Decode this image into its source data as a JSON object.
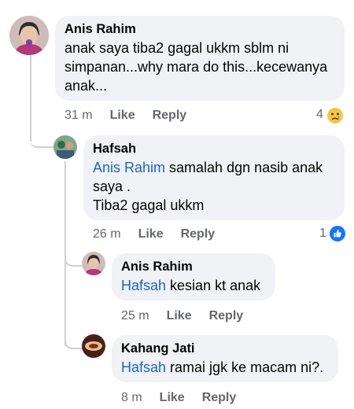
{
  "comments": [
    {
      "author": "Anis Rahim",
      "text": "anak saya tiba2 gagal ukkm sblm ni simpanan...why mara do this...kecewanya anak...",
      "time": "31 m",
      "like": "Like",
      "reply": "Reply",
      "reaction_count": "4",
      "reaction_icon": "sad-face-icon"
    },
    {
      "author": "Hafsah",
      "mention": "Anis Rahim",
      "text_line1": " samalah dgn nasib anak",
      "text_line2": "saya .",
      "text_line3": "Tiba2 gagal ukkm",
      "time": "26 m",
      "like": "Like",
      "reply": "Reply",
      "reaction_count": "1",
      "reaction_icon": "like-thumb-icon"
    },
    {
      "author": "Anis Rahim",
      "mention": "Hafsah",
      "text": " kesian kt anak",
      "time": "25 m",
      "like": "Like",
      "reply": "Reply"
    },
    {
      "author": "Kahang Jati",
      "mention": "Hafsah",
      "text": " ramai jgk ke macam ni?.",
      "time": "8 m",
      "like": "Like",
      "reply": "Reply"
    }
  ],
  "colors": {
    "bubble": "#f0f2f5",
    "mention": "#1a66c4",
    "meta": "#65676b",
    "like_blue": "#1877f2",
    "sad_yellow": "#f7c548"
  }
}
